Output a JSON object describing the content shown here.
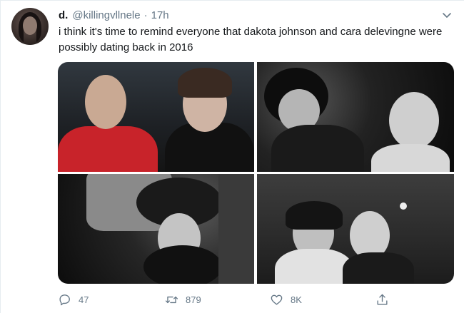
{
  "tweet": {
    "display_name": "d.",
    "handle": "@killingvllnele",
    "separator": "·",
    "time": "17h",
    "text": "i think it's time to remind everyone that dakota johnson and cara delevingne were possibly dating back in 2016"
  },
  "actions": {
    "reply_count": "47",
    "retweet_count": "879",
    "like_count": "8K"
  },
  "icons": {
    "reply": "reply-icon",
    "retweet": "retweet-icon",
    "like": "heart-icon",
    "share": "share-icon",
    "more": "chevron-down-icon"
  },
  "colors": {
    "text": "#14171a",
    "secondary": "#657786",
    "border": "#e6ecf0"
  }
}
